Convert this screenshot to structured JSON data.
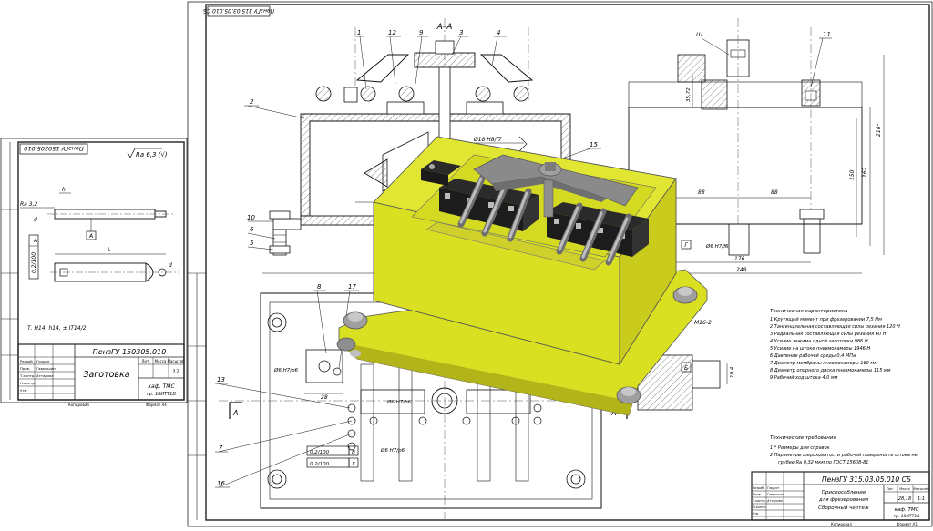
{
  "sheet_left": {
    "stamp_rotated": "ПензГУ 150305.010",
    "roughness_sign": "Ra 6,3 (√)",
    "callout_ra": "Ra 3,2",
    "callout_h": "h",
    "callout_d": "d",
    "datum_a": "A",
    "tolerance_value": "0,2/100",
    "tolerance_datum": "A",
    "dim_l": "L",
    "dim_d": "d",
    "tech_note": "Т. H14, h14, ± IT14/2",
    "doc_code": "ПензГУ 150305.010",
    "title": "Заготовка",
    "sheet_number": "12",
    "dept": "каф. ТМС",
    "group": "гр. 18ИТТ1В",
    "hdr_lit": "Лит.",
    "hdr_mass": "Масса",
    "hdr_scale": "Масштаб",
    "row_labels": [
      "Разраб.",
      "Пров.",
      "Т.контр.",
      "Н.контр.",
      "Утв."
    ],
    "names": [
      "Гордон",
      "Гаврюшин",
      "Аттарова"
    ],
    "footer_copy": "Копировал",
    "footer_format": "Формат А4"
  },
  "sheet_right": {
    "stamp_rotated": "ПензГУ 315.03.05.010 СБ",
    "section_label": "А–А",
    "view_arrow_left": "А",
    "view_arrow_right": "А",
    "balloons": [
      "1",
      "12",
      "9",
      "3",
      "4",
      "2",
      "10",
      "6",
      "5",
      "8",
      "17",
      "15",
      "11",
      "13",
      "7",
      "16"
    ],
    "fit_1": "Ø18 H8/f7",
    "fit_2": "Ø6 H7/f6",
    "fit_3": "Ø6 H7/p6",
    "fit_4": "Ø6 H7/p6",
    "fit_5": "Ø6 H7/h6",
    "dim_28": "28",
    "dim_88a": "88",
    "dim_88b": "88",
    "dim_176": "176",
    "dim_248": "248",
    "dim_218": "218*",
    "dim_162": "162",
    "dim_150": "150",
    "dim_3572": "35,72",
    "dim_sh": "Ш",
    "dim_m16": "M16-2",
    "dim_104": "10,4",
    "view_g": "Г",
    "view_b": "Б",
    "tol_1": "0,2/100",
    "tol_1_datum": "В",
    "tol_2": "0,2/100",
    "tol_2_datum": "Г",
    "specs_title": "Техническая характеристика",
    "specs": [
      "1 Крутящий момент при фрезеровании 7,5 Нм",
      "2 Тангенциальная составляющая силы резания 120 Н",
      "3 Радиальная составляющая силы резания 60 Н",
      "4 Усилие зажима одной заготовки 986 Н",
      "5 Усилие на штоке пневмокамеры 1946 Н",
      "6 Давление рабочей среды 0,4 МПа",
      "7 Диаметр мембраны пневмокамеры 160 мм",
      "8 Диаметр опорного диска пневмокамеры 115 мм",
      "9 Рабочий ход штока 4,0 мм"
    ],
    "req_title": "Технические требования",
    "reqs": [
      "1 * Размеры для справок",
      "2 Параметры шероховатости рабочей поверхности штока не",
      "грубее Ra 0,32 мкм по ГОСТ 15608-81"
    ],
    "doc_code": "ПензГУ 315.03.05.010 СБ",
    "title_1": "Приспособление",
    "title_2": "для фрезерования",
    "title_3": "Сборочный чертеж",
    "mass": "28,18",
    "scale": "1:1",
    "dept": "каф. ТМС",
    "group": "гр. 18ИТТ1В",
    "hdr_lit": "Лит.",
    "hdr_mass": "Масса",
    "hdr_scale": "Масштаб",
    "row_labels": [
      "Разраб.",
      "Пров.",
      "Т.контр.",
      "Н.контр.",
      "Утв."
    ],
    "names": [
      "Гордон",
      "Гаврюшин",
      "Аттарова"
    ],
    "footer_copy": "Копировал",
    "footer_format": "Формат А1"
  },
  "colors": {
    "model_body": "#d9e021",
    "model_dark": "#b3b31a",
    "model_gray": "#9e9e9e",
    "block_black": "#1c1c1c",
    "line": "#1a1a1a",
    "hatch": "#3a3a3a"
  }
}
